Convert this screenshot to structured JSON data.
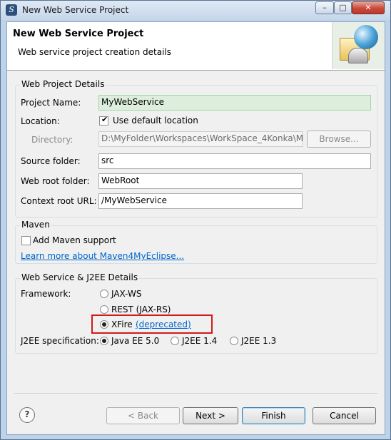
{
  "window": {
    "title": "New Web Service Project"
  },
  "header": {
    "title": "New Web Service Project",
    "description": "Web service project creation details"
  },
  "web_project": {
    "legend": "Web Project Details",
    "project_name_label": "Project Name:",
    "project_name_value": "MyWebService",
    "location_label": "Location:",
    "use_default_label": "Use default location",
    "use_default_checked": true,
    "directory_label": "Directory:",
    "directory_value": "D:\\MyFolder\\Workspaces\\WorkSpace_4Konka\\M",
    "browse_label": "Browse...",
    "source_folder_label": "Source folder:",
    "source_folder_value": "src",
    "web_root_label": "Web root folder:",
    "web_root_value": "WebRoot",
    "context_root_label": "Context root URL:",
    "context_root_value": "/MyWebService"
  },
  "maven": {
    "legend": "Maven",
    "add_support_label": "Add Maven support",
    "add_support_checked": false,
    "learn_more_link": "Learn more about Maven4MyEclipse..."
  },
  "ws_details": {
    "legend": "Web Service & J2EE Details",
    "framework_label": "Framework:",
    "framework_options": [
      "JAX-WS",
      "REST (JAX-RS)",
      "XFire"
    ],
    "framework_selected": "XFire",
    "deprecated_link": "(deprecated)",
    "j2ee_label": "J2EE specification:",
    "j2ee_options": [
      "Java EE 5.0",
      "J2EE 1.4",
      "J2EE 1.3"
    ],
    "j2ee_selected": "Java EE 5.0"
  },
  "buttons": {
    "back": "< Back",
    "next": "Next >",
    "finish": "Finish",
    "cancel": "Cancel",
    "help": "?"
  }
}
